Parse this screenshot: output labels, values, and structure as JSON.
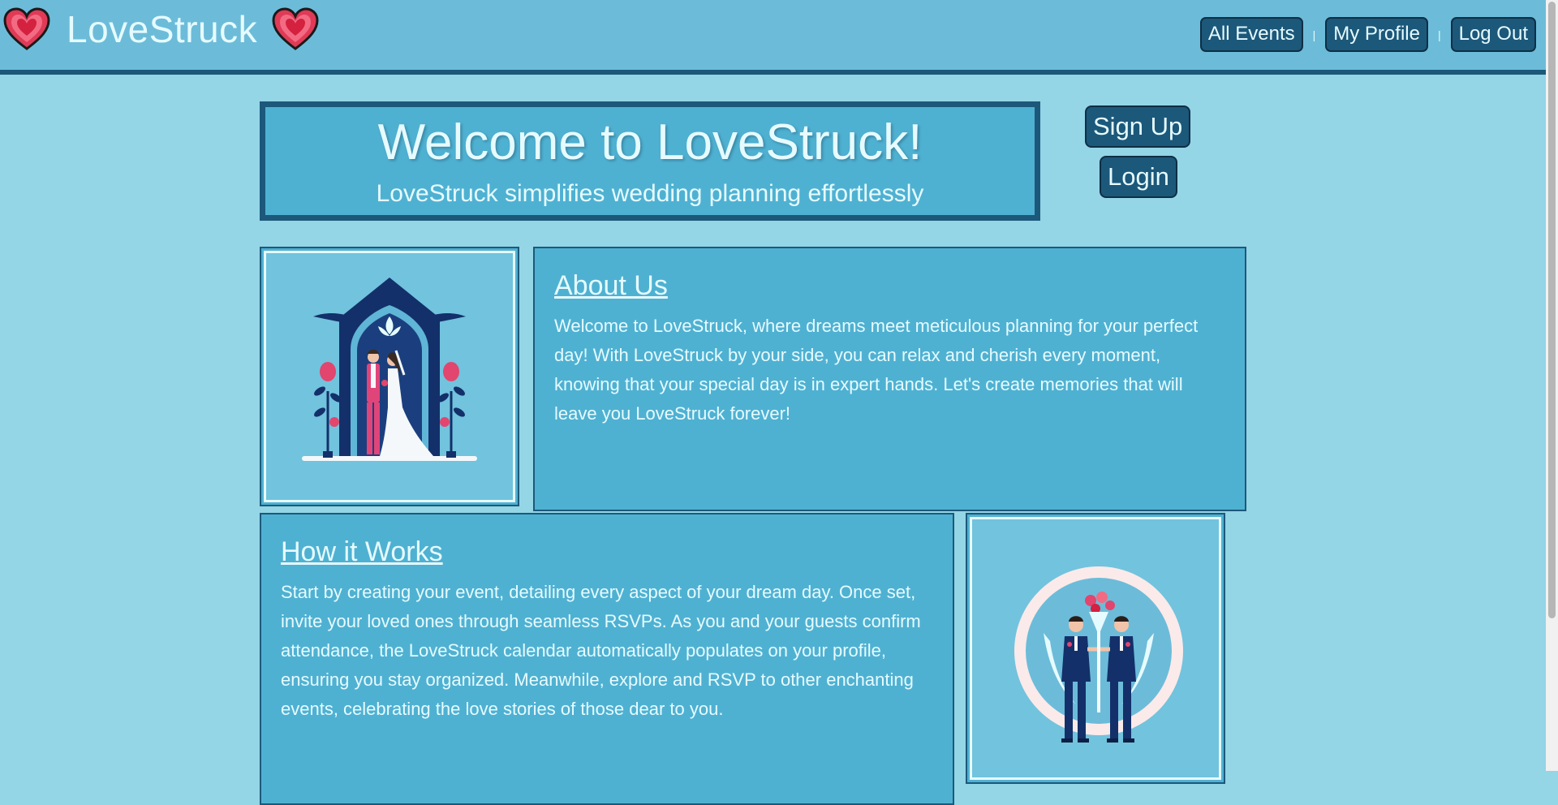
{
  "header": {
    "brand": "LoveStruck",
    "nav": [
      "All Events",
      "My Profile",
      "Log Out"
    ],
    "separator": "|"
  },
  "welcome": {
    "title": "Welcome to LoveStruck!",
    "subtitle": "LoveStruck simplifies wedding planning effortlessly"
  },
  "auth": {
    "signup": "Sign Up",
    "login": "Login"
  },
  "about": {
    "heading": "About Us",
    "body": "Welcome to LoveStruck, where dreams meet meticulous planning for your perfect day! With LoveStruck by your side, you can relax and cherish every moment, knowing that your special day is in expert hands. Let's create memories that will leave you LoveStruck forever!"
  },
  "how": {
    "heading": "How it Works",
    "body": "Start by creating your event, detailing every aspect of your dream day. Once set, invite your loved ones through seamless RSVPs. As you and your guests confirm attendance, the LoveStruck calendar automatically populates on your profile, ensuring you stay organized. Meanwhile, explore and RSVP to other enchanting events, celebrating the love stories of those dear to you."
  },
  "icons": [
    "heart-icon",
    "wedding-arch-illustration",
    "grooms-illustration"
  ],
  "colors": {
    "page_bg": "#94d5e6",
    "header_bg": "#6cbcd9",
    "accent": "#1c587a",
    "panel": "#4fb1d2",
    "text": "#e6fbff"
  }
}
